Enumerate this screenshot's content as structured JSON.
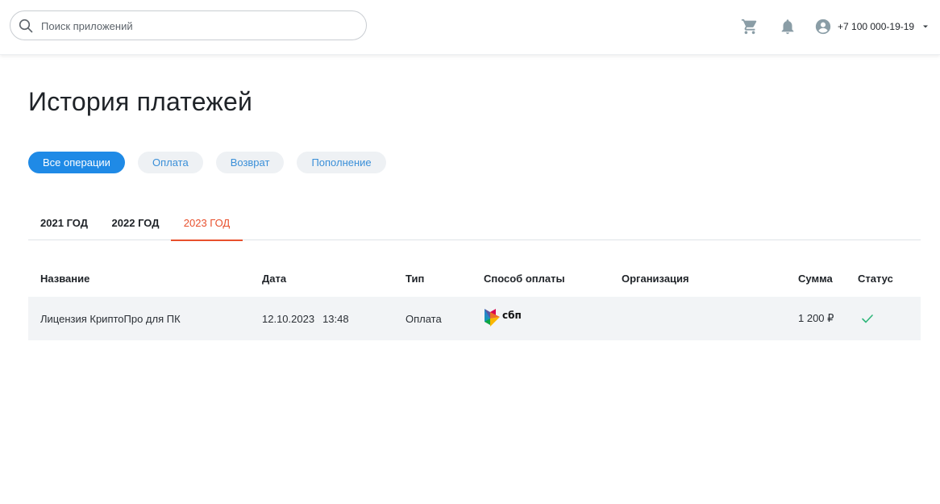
{
  "header": {
    "search": {
      "placeholder": "Поиск приложений",
      "value": ""
    },
    "phone": "+7 100 000-19-19"
  },
  "page": {
    "title": "История платежей",
    "filters": [
      {
        "label": "Все операции",
        "active": true
      },
      {
        "label": "Оплата",
        "active": false
      },
      {
        "label": "Возврат",
        "active": false
      },
      {
        "label": "Пополнение",
        "active": false
      }
    ],
    "years": [
      {
        "label": "2021 ГОД",
        "active": false
      },
      {
        "label": "2022 ГОД",
        "active": false
      },
      {
        "label": "2023 ГОД",
        "active": true
      }
    ]
  },
  "table": {
    "columns": [
      "Название",
      "Дата",
      "Тип",
      "Способ оплаты",
      "Организация",
      "Сумма",
      "Статус"
    ],
    "rows": [
      {
        "name": "Лицензия КриптоПро для ПК",
        "date": "12.10.2023",
        "time": "13:48",
        "type": "Оплата",
        "method_logo_text": "сбп",
        "method_icon": "sbp-logo-icon",
        "organization": "",
        "amount": "1 200 ₽",
        "status_icon": "check-icon"
      }
    ]
  },
  "colors": {
    "accent": "#1f8ae6",
    "active_tab": "#e8502d",
    "success": "#2fb67a",
    "icon_gray": "#8a9da6"
  }
}
